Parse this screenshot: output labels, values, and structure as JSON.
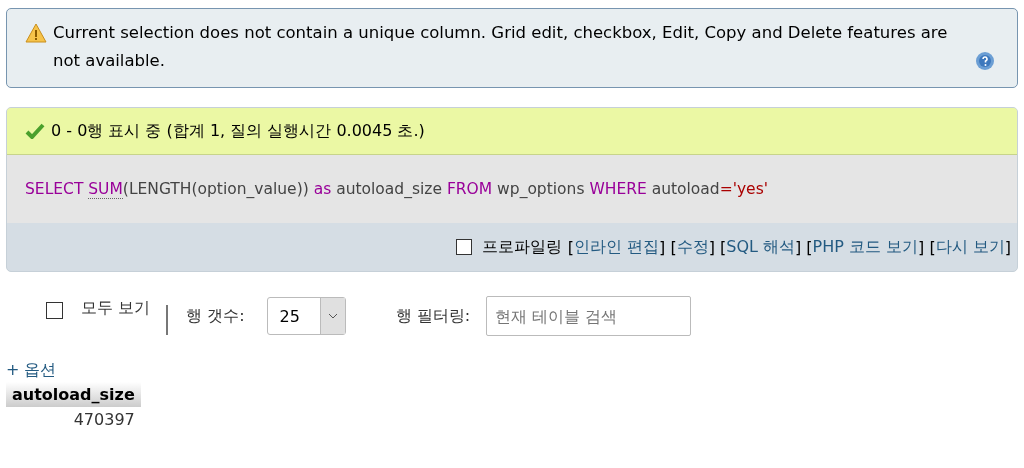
{
  "notice": {
    "text": "Current selection does not contain a unique column. Grid edit, checkbox, Edit, Copy and Delete features are not available."
  },
  "result": {
    "message": "0 - 0행 표시 중 (합계 1, 질의 실행시간 0.0045 초.)",
    "sql": [
      {
        "text": "SELECT ",
        "kind": "keyword"
      },
      {
        "text": "SUM",
        "kind": "function"
      },
      {
        "text": "(LENGTH(option_value)) ",
        "kind": "plain"
      },
      {
        "text": "as",
        "kind": "keyword"
      },
      {
        "text": " autoload_size ",
        "kind": "plain"
      },
      {
        "text": "FROM",
        "kind": "keyword"
      },
      {
        "text": " wp_options ",
        "kind": "plain"
      },
      {
        "text": "WHERE",
        "kind": "keyword"
      },
      {
        "text": " autoload",
        "kind": "plain"
      },
      {
        "text": "=",
        "kind": "operator"
      },
      {
        "text": "'yes'",
        "kind": "string"
      }
    ],
    "profiling": {
      "label": "프로파일링",
      "checked": false
    },
    "actions": [
      {
        "text": "[",
        "kind": "bracket"
      },
      {
        "text": "인라인 편집",
        "kind": "link"
      },
      {
        "text": "] [",
        "kind": "bracket"
      },
      {
        "text": "수정",
        "kind": "link"
      },
      {
        "text": "] [",
        "kind": "bracket"
      },
      {
        "text": "SQL 해석",
        "kind": "link"
      },
      {
        "text": "] [",
        "kind": "bracket"
      },
      {
        "text": "PHP 코드 보기",
        "kind": "link"
      },
      {
        "text": "] [",
        "kind": "bracket"
      },
      {
        "text": "다시 보기",
        "kind": "link"
      },
      {
        "text": "]",
        "kind": "bracket"
      }
    ]
  },
  "controls": {
    "show_all": {
      "label": "모두 보기",
      "checked": false
    },
    "rows_label": "행 갯수:",
    "rows_value": "25",
    "filter_label": "행 필터링:",
    "filter_placeholder": "현재 테이블 검색"
  },
  "options_link": "+ 옵션",
  "table": {
    "columns": [
      "autoload_size"
    ],
    "rows": [
      [
        "470397"
      ]
    ]
  }
}
